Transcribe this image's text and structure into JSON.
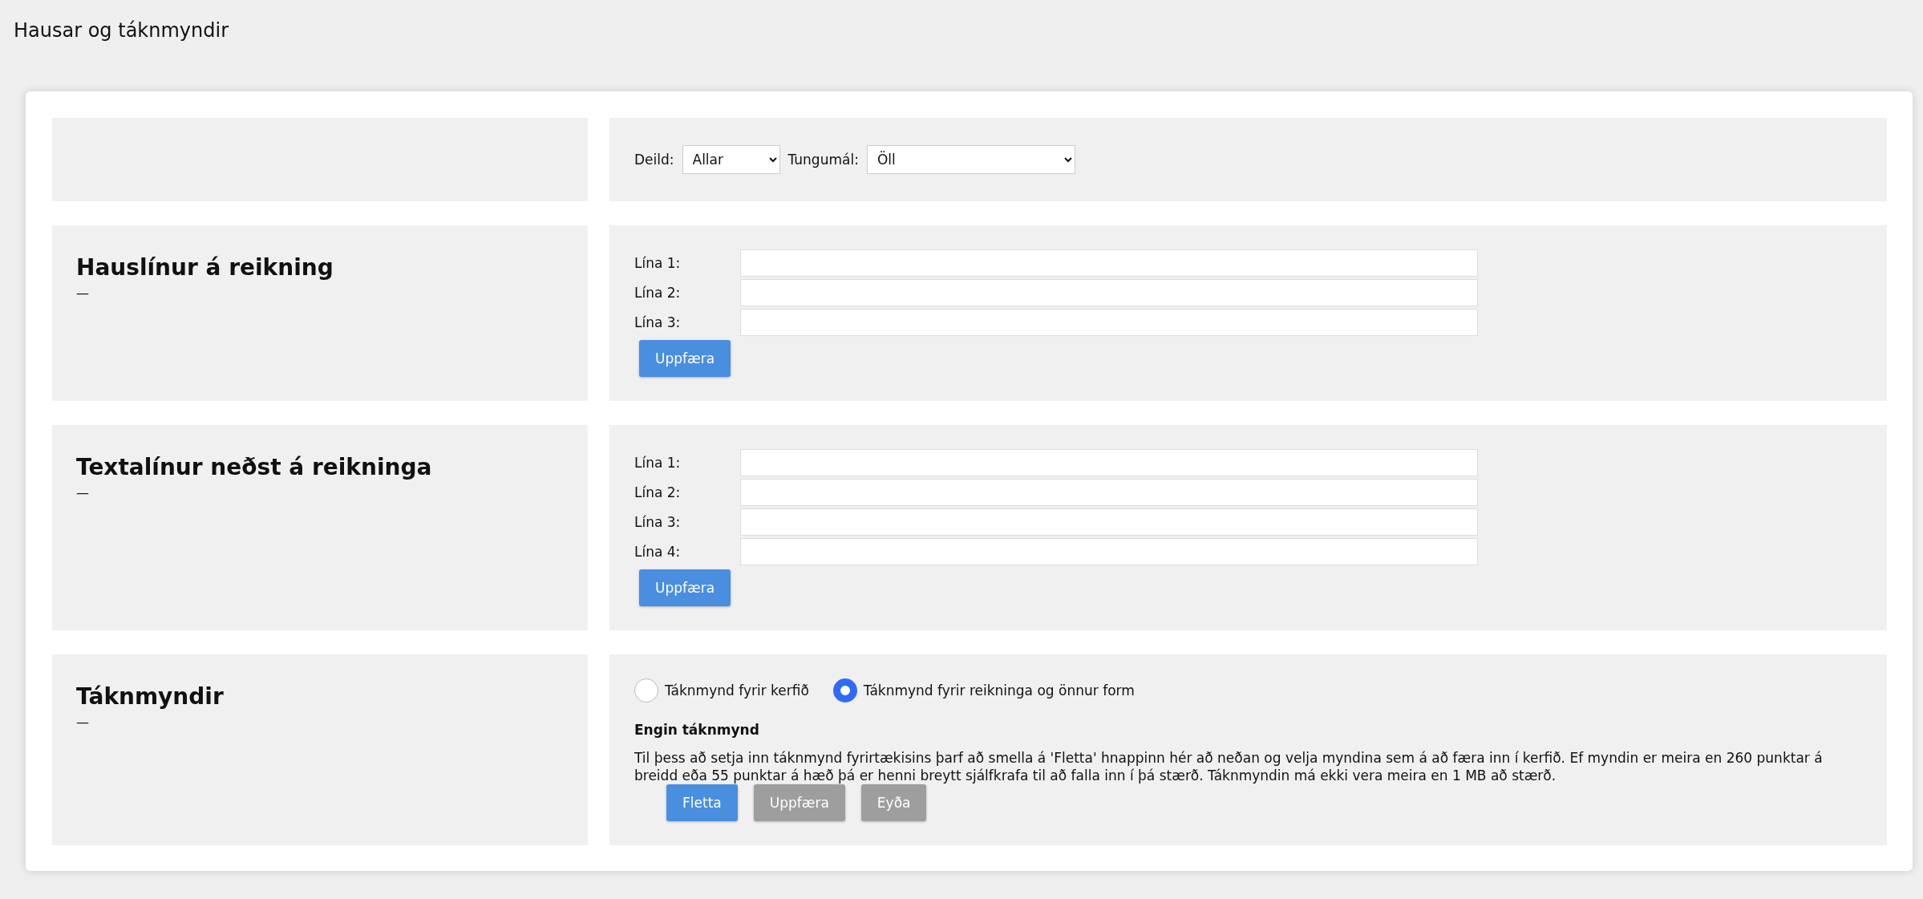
{
  "page_title": "Hausar og táknmyndir",
  "filters": [
    {
      "label": "Deild:",
      "value": "Allar"
    },
    {
      "label": "Tungumál:",
      "value": "Öll"
    }
  ],
  "sections": [
    {
      "kind": "lines",
      "heading": "Hauslínur á reikning",
      "subtitle": "—",
      "lines": [
        {
          "label": "Lína 1:"
        },
        {
          "label": "Lína 2:"
        },
        {
          "label": "Lína 3:"
        }
      ],
      "button": "Uppfæra"
    },
    {
      "kind": "lines",
      "heading": "Textalínur neðst á reikninga",
      "subtitle": "—",
      "lines": [
        {
          "label": "Lína 1:"
        },
        {
          "label": "Lína 2:"
        },
        {
          "label": "Lína 3:"
        },
        {
          "label": "Lína 4:"
        }
      ],
      "button": "Uppfæra"
    },
    {
      "kind": "logo",
      "heading": "Táknmyndir",
      "subtitle": "—",
      "options": [
        {
          "label": "Táknmynd fyrir kerfið",
          "selected": false
        },
        {
          "label": "Táknmynd fyrir reikninga og önnur form",
          "selected": true
        }
      ],
      "status": "Engin táknmynd",
      "description": "Til þess að setja inn táknmynd fyrirtækisins þarf að smella á 'Fletta' hnappinn hér að neðan og velja myndina sem á að færa inn í kerfið. Ef myndin er meira en 260 punktar á breidd eða 55 punktar á hæð þá er henni breytt sjálfkrafa til að falla inn í þá stærð. Táknmyndin má ekki vera meira en 1 MB að stærð.",
      "buttons": [
        {
          "label": "Fletta",
          "disabled": false
        },
        {
          "label": "Uppfæra",
          "disabled": true
        },
        {
          "label": "Eyða",
          "disabled": true
        }
      ]
    }
  ]
}
